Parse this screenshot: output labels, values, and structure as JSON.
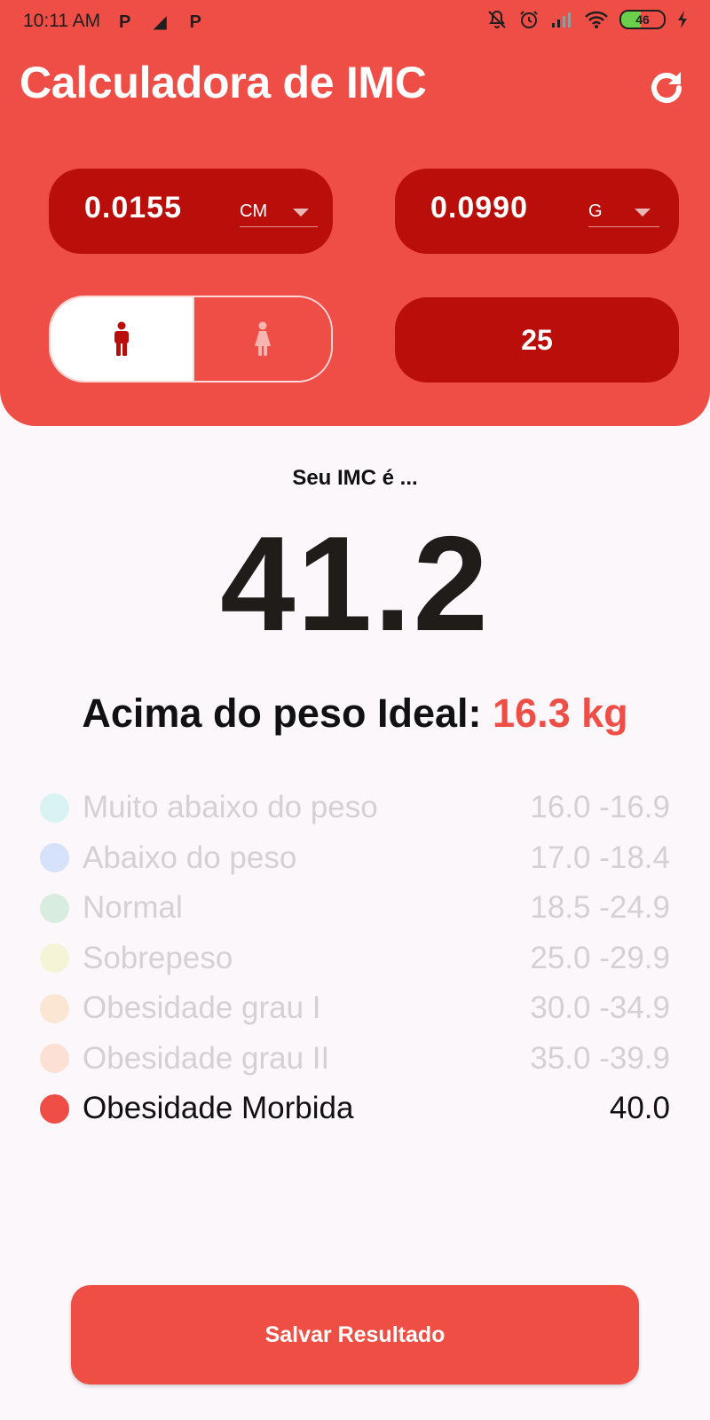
{
  "status_bar": {
    "time": "10:11 AM",
    "app_icons": "P ◢ P",
    "battery_level": 46,
    "battery_label": "46",
    "icons": [
      "bell-muted-icon",
      "alarm-icon",
      "signal-icon",
      "wifi-icon",
      "battery-icon",
      "charging-icon"
    ]
  },
  "header": {
    "title": "Calculadora de IMC",
    "refresh_icon": "refresh-icon",
    "background_color": "#EF4E46"
  },
  "inputs": {
    "height": {
      "value": "0.0155",
      "unit": "CM"
    },
    "weight": {
      "value": "0.0990",
      "unit": "G"
    },
    "gender": {
      "selected": "male",
      "options": [
        "male-icon",
        "female-icon"
      ]
    },
    "age": {
      "value": "25"
    }
  },
  "result": {
    "heading": "Seu IMC é ...",
    "bmi": "41.2",
    "weight_diff_label": "Acima do peso Ideal:",
    "weight_diff_value": "16.3 kg"
  },
  "categories": [
    {
      "name": "Muito abaixo do peso",
      "range": "16.0 -16.9",
      "color": "#D8F3F2",
      "active": false
    },
    {
      "name": "Abaixo do peso",
      "range": "17.0 -18.4",
      "color": "#D6E1FA",
      "active": false
    },
    {
      "name": "Normal",
      "range": "18.5 -24.9",
      "color": "#D8EDDE",
      "active": false
    },
    {
      "name": "Sobrepeso",
      "range": "25.0 -29.9",
      "color": "#F6F4D6",
      "active": false
    },
    {
      "name": "Obesidade grau I",
      "range": "30.0 -34.9",
      "color": "#FBE6D4",
      "active": false
    },
    {
      "name": "Obesidade grau II",
      "range": "35.0 -39.9",
      "color": "#FBE0D3",
      "active": false
    },
    {
      "name": "Obesidade Morbida",
      "range": "40.0",
      "color": "#EF4E46",
      "active": true
    }
  ],
  "save_button": {
    "label": "Salvar Resultado"
  }
}
